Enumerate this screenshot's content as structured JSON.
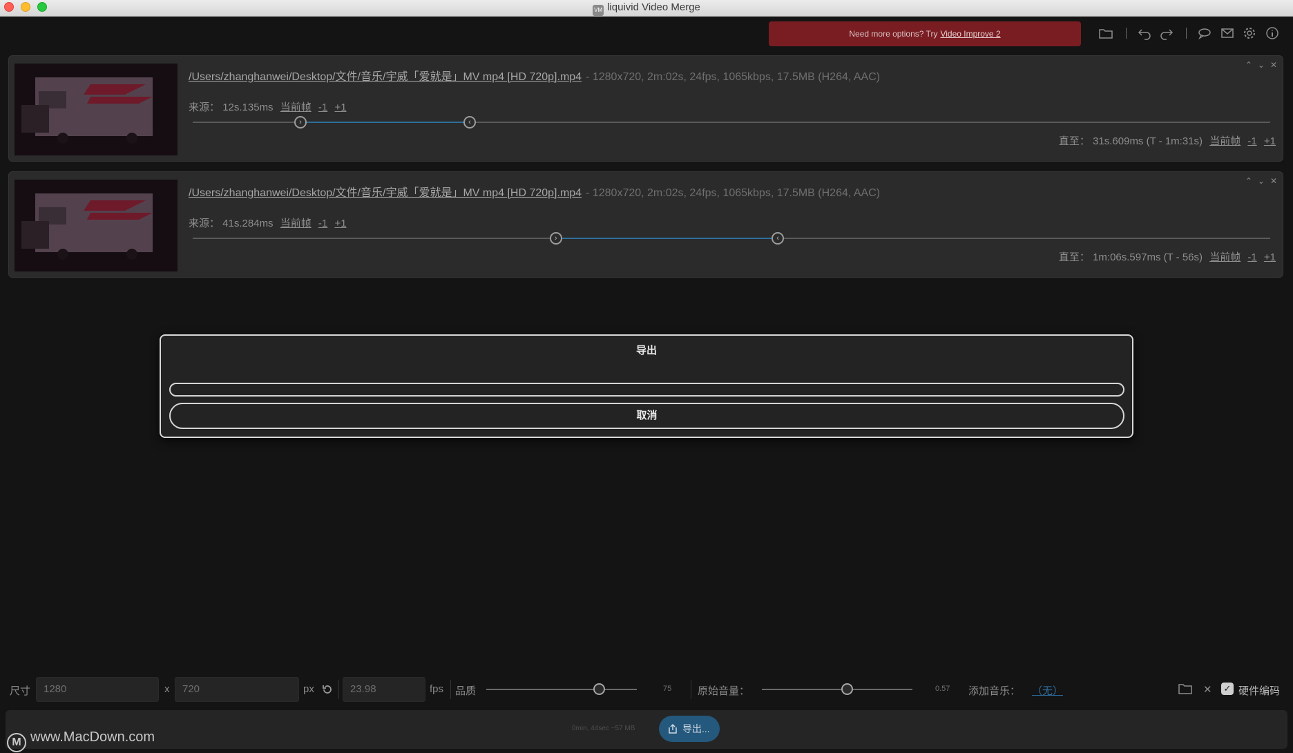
{
  "window": {
    "title": "liquivid Video Merge",
    "app_icon": "VM"
  },
  "toolbar": {
    "promo_text": "Need more options? Try",
    "promo_link": "Video Improve 2",
    "icons": [
      "folder-icon",
      "undo-icon",
      "redo-icon",
      "chat-icon",
      "mail-icon",
      "gear-icon",
      "info-icon"
    ]
  },
  "clips": [
    {
      "path": "/Users/zhanghanwei/Desktop/文件/音乐/宇威「爱就是」MV mp4 [HD 720p].mp4",
      "meta": "-  1280x720, 2m:02s, 24fps, 1065kbps, 17.5MB (H264, AAC)",
      "source_label": "来源：",
      "source_time": "12s.135ms",
      "current_frame": "当前帧",
      "minus": "-1",
      "plus": "+1",
      "until_label": "直至：",
      "until_time": "31s.609ms (T - 1m:31s)",
      "range_start": 0.1,
      "range_end": 0.257
    },
    {
      "path": "/Users/zhanghanwei/Desktop/文件/音乐/宇威「爱就是」MV mp4 [HD 720p].mp4",
      "meta": "-  1280x720, 2m:02s, 24fps, 1065kbps, 17.5MB (H264, AAC)",
      "source_label": "来源：",
      "source_time": "41s.284ms",
      "current_frame": "当前帧",
      "minus": "-1",
      "plus": "+1",
      "until_label": "直至：",
      "until_time": "1m:06s.597ms (T - 56s)",
      "range_start": 0.337,
      "range_end": 0.543
    }
  ],
  "dialog": {
    "title": "导出",
    "cancel": "取消"
  },
  "settings": {
    "size_label": "尺寸",
    "width": "1280",
    "x": "x",
    "height": "720",
    "px": "px",
    "fps_value": "23.98",
    "fps": "fps",
    "quality_label": "品质",
    "quality_value": "75",
    "quality_level": 0.75,
    "volume_label": "原始音量：",
    "volume_value": "0.57",
    "volume_level": 0.57,
    "music_label": "添加音乐：",
    "music_value": "（无）",
    "hw_label": "硬件编码",
    "hw_checked": true
  },
  "footer": {
    "estimate": "0min, 44sec ~57 MB",
    "export_label": "导出..."
  },
  "watermark": {
    "text": "www.MacDown.com",
    "logo": "M"
  }
}
